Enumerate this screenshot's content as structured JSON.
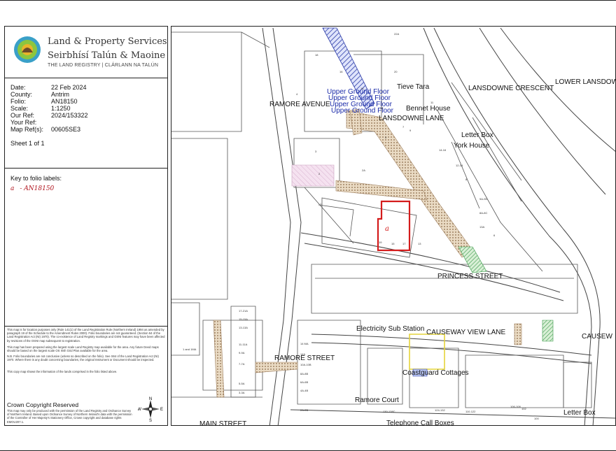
{
  "header": {
    "org_name_en": "Land & Property Services",
    "org_name_ga": "Seirbhísí Talún & Maoine",
    "registry_line": "THE LAND REGISTRY | CLÁRLANN NA TALÚN"
  },
  "info": {
    "rows": [
      {
        "label": "Date:",
        "value": "22 Feb 2024"
      },
      {
        "label": "County:",
        "value": "Antrim"
      },
      {
        "label": "Folio:",
        "value": "AN18150"
      },
      {
        "label": "Scale:",
        "value": "1:1250"
      },
      {
        "label": "Our Ref:",
        "value": "2024/153322"
      },
      {
        "label": "Your Ref:",
        "value": ""
      },
      {
        "label": "Map Ref(s):",
        "value": "00605SE3"
      }
    ],
    "sheet": "Sheet 1 of 1"
  },
  "key": {
    "title": "Key to folio labels:",
    "items": [
      {
        "letter": "a",
        "label": "- AN18150"
      }
    ]
  },
  "notes": {
    "p1": "This map is for location purposes only (Rule 141(1) of the Land Registration Rule (Northern Ireland) 1994 as amended by paragraph 19 of the Schedule to the Amendment Rules 2000). Folio boundaries are not guaranteed. (Section 64 of the Land Registration Act (NI) 1970). The co-existence of Land Registry markings and OSNI features may have been affected by revisions of the OSNI map subsequent to registration.",
    "p2": "This map has been prepared using the largest scale Land Registry map available for the area. Any future Deed maps should be based on the largest scale OS Irish Grid Plan available for the area.",
    "p3": "N.B. Folio boundaries are not conclusive (unless so described on the folio). See S64 of the Land Registration Act (NI) 1970. Where there is any doubt concerning boundaries, the original Instrument or Document should be inspected.",
    "p4": "This copy map shows the information of the lands comprised in the folio listed above.",
    "crown_title": "Crown Copyright Reserved",
    "crown_text": "This map may only be produced with the permission of the Land Registry and Ordnance Survey of Northern Ireland. Based upon Ordnance Survey of Northern Ireland's data with the permission of the Controller of Her Majesty's Stationery Office, Crown copyright and database rights EMOU207.1."
  },
  "compass": {
    "n": "N",
    "e": "E",
    "s": "S",
    "w": "W"
  },
  "map": {
    "streets": {
      "lower_lansdowne": "LOWER LANSDOWNE",
      "lansdowne_crescent": "LANSDOWNE CRESCENT",
      "ramore_avenue": "RAMORE AVENUE",
      "lansdowne_lane": "LANSDOWNE LANE",
      "princess_street": "PRINCESS STREET",
      "causeway_view_lane": "CAUSEWAY VIEW LANE",
      "causeway": "CAUSEW",
      "ramore_street": "RAMORE STREET",
      "main_street": "MAIN STREET"
    },
    "places": {
      "tieve_tara": "Tieve Tara",
      "bennet_house": "Bennet House",
      "letter_box_1": "Letter Box",
      "york_house": "York House",
      "electricity_sub_station": "Electricity Sub Station",
      "coastguard_cottages": "Coastguard Cottages",
      "ramore_court": "Ramore Court",
      "letter_box_2": "Letter Box",
      "telephone_call_boxes": "Telephone Call Boxes"
    },
    "overlay_labels": {
      "ug1": "Upper Ground Floor",
      "ug2": "Upper Ground Floor",
      "ug3": "Upper Ground Floor",
      "ug4": "Upper Ground Floor",
      "folio_letter": "a"
    },
    "house_numbers": {
      "n22a": "22A",
      "n20": "20",
      "n2a": "2A",
      "n16": "16",
      "n18": "18",
      "n10": "10",
      "n14": "14",
      "n11": "11",
      "n4": "4",
      "n9": "9",
      "n5": "5",
      "n7": "7",
      "n1416": "14-16",
      "n1214": "12-14",
      "n1": "1",
      "n3": "3",
      "n2": "2",
      "n17": "17",
      "n6": "6",
      "n8": "8",
      "n9a": "9A-9D",
      "n8a": "8A-8C",
      "n13a": "13A",
      "mainhall": "1 and 1MA",
      "n14ma": "14 MA",
      "n14a": "14A",
      "n10ab": "10A-10B",
      "n8ab": "8A-8B",
      "n6ab": "6A-6B",
      "n4ab": "4A-4B",
      "n2ab": "2A-2B",
      "n130": "130-138C",
      "n124": "124-132",
      "n110": "110-122",
      "n106": "106-108",
      "n100": "100",
      "n102": "102",
      "n17a": "17-21A",
      "n15a": "15-15A",
      "n13ab": "13-13A",
      "n11a": "11-11A",
      "n9ab": "9-9A",
      "n7a": "7-7A",
      "n5a": "5-5A",
      "n3a": "3-3A",
      "n15": "15",
      "n13": "13",
      "n19": "19"
    }
  }
}
